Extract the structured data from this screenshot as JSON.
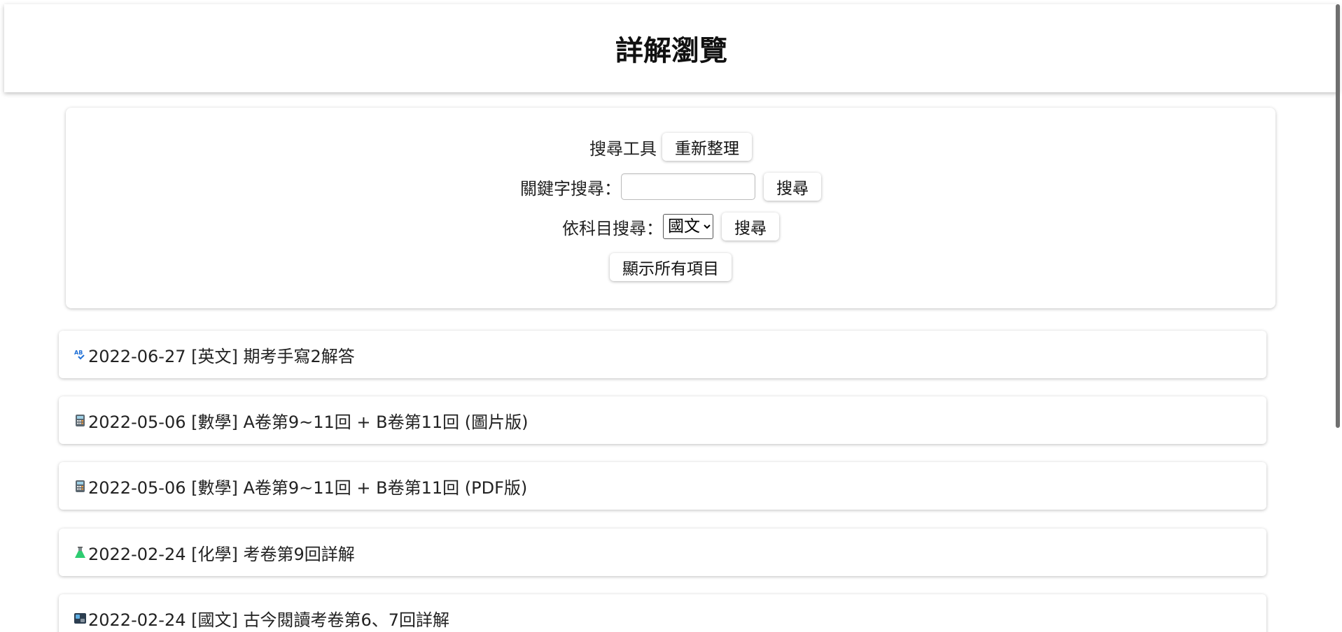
{
  "header": {
    "title": "詳解瀏覽"
  },
  "search": {
    "tools_label": "搜尋工具",
    "refresh_label": "重新整理",
    "keyword_label": "關鍵字搜尋：",
    "keyword_value": "",
    "keyword_search_label": "搜尋",
    "subject_label": "依科目搜尋：",
    "subject_selected": "國文",
    "subject_search_label": "搜尋",
    "show_all_label": "顯示所有項目"
  },
  "items": [
    {
      "icon": "abc-spellcheck-icon",
      "text": "2022-06-27 [英文] 期考手寫2解答"
    },
    {
      "icon": "calculator-icon",
      "text": "2022-05-06 [數學] A卷第9~11回 + B卷第11回 (圖片版)"
    },
    {
      "icon": "calculator-icon",
      "text": "2022-05-06 [數學] A卷第9~11回 + B卷第11回 (PDF版)"
    },
    {
      "icon": "flask-icon",
      "text": "2022-02-24 [化學] 考卷第9回詳解"
    },
    {
      "icon": "book-icon",
      "text": "2022-02-24 [國文] 古今閱讀考卷第6、7回詳解"
    }
  ],
  "colors": {
    "accent_blue": "#1e6fd6",
    "flask_green": "#2ecc71"
  }
}
